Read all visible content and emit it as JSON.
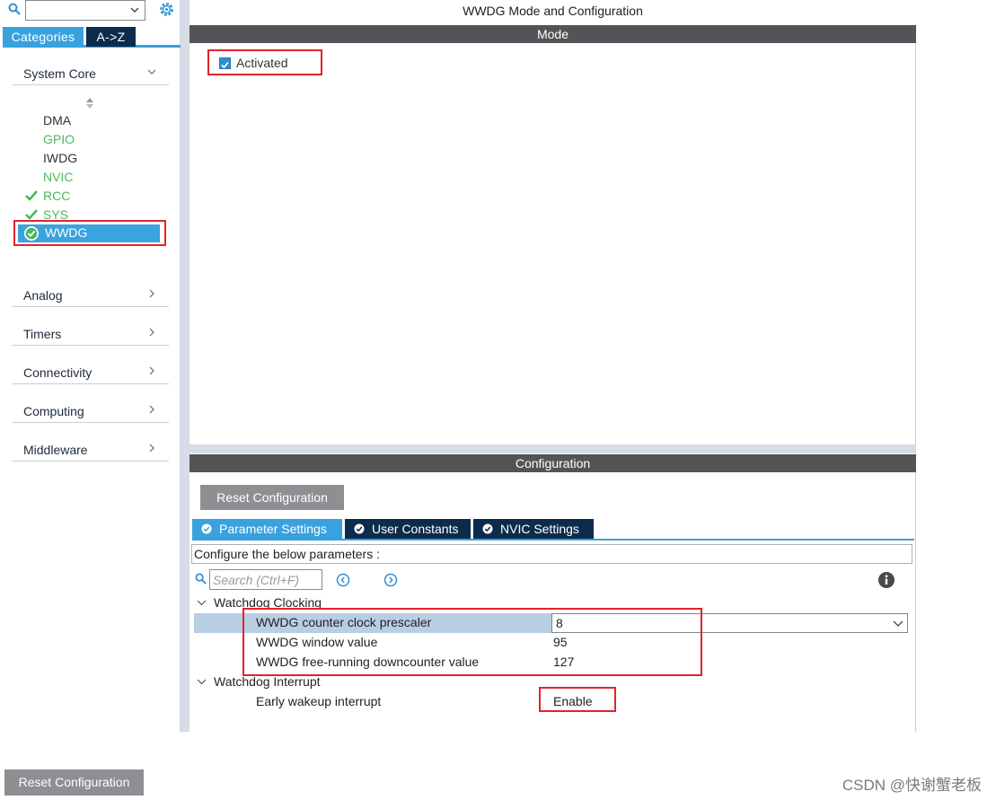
{
  "sidebar": {
    "search_value": "",
    "tabs": [
      "Categories",
      "A->Z"
    ],
    "system_core": {
      "label": "System Core",
      "items": [
        {
          "label": "DMA",
          "state": "plain"
        },
        {
          "label": "GPIO",
          "state": "green"
        },
        {
          "label": "IWDG",
          "state": "plain"
        },
        {
          "label": "NVIC",
          "state": "green"
        },
        {
          "label": "RCC",
          "state": "checked"
        },
        {
          "label": "SYS",
          "state": "checked"
        },
        {
          "label": "WWDG",
          "state": "selected"
        }
      ]
    },
    "groups": [
      "Analog",
      "Timers",
      "Connectivity",
      "Computing",
      "Middleware"
    ]
  },
  "main": {
    "title": "WWDG Mode and Configuration",
    "mode_header": "Mode",
    "activated_label": "Activated",
    "activated_checked": true,
    "config_header": "Configuration",
    "reset_label": "Reset Configuration",
    "tabs": [
      "Parameter Settings",
      "User Constants",
      "NVIC Settings"
    ],
    "description": "Configure the below parameters :",
    "search_placeholder": "Search (Ctrl+F)",
    "clocking_group": "Watchdog Clocking",
    "interrupt_group": "Watchdog Interrupt",
    "params": [
      {
        "name": "WWDG counter clock prescaler",
        "value": "8"
      },
      {
        "name": "WWDG window value",
        "value": "95"
      },
      {
        "name": "WWDG free-running downcounter value",
        "value": "127"
      }
    ],
    "interrupt_param": {
      "name": "Early wakeup interrupt",
      "value": "Enable"
    }
  },
  "footer": {
    "reset_label": "Reset Configuration",
    "watermark": "CSDN @快谢蟹老板"
  },
  "colors": {
    "accent_blue": "#39a2de",
    "dark_tab": "#0d2c4c",
    "header_bar": "#525457",
    "highlight_red": "#e0242c",
    "ok_green": "#4bb85e"
  }
}
